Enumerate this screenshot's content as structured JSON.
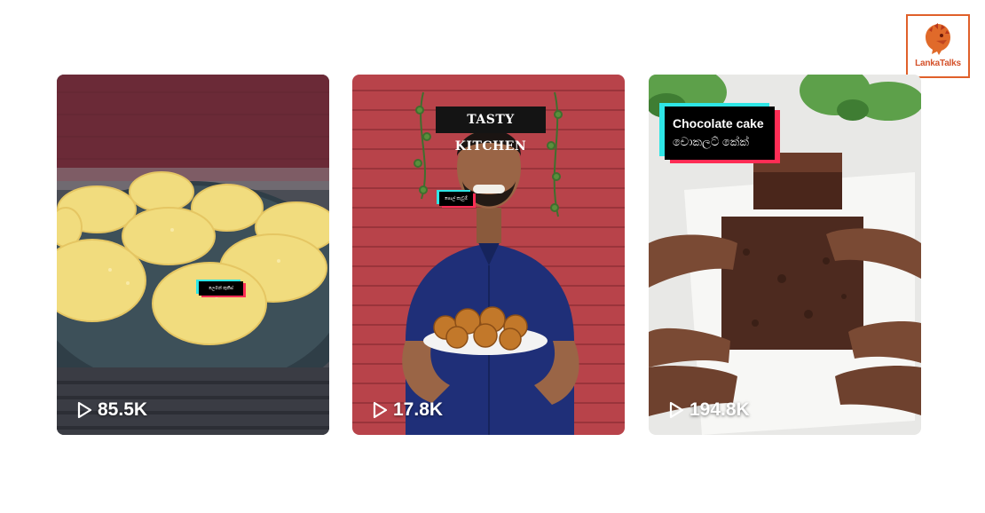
{
  "logo": {
    "text": "LankaTalks",
    "icon": "lion-icon"
  },
  "colors": {
    "accent_orange": "#e0602a",
    "tag_cyan": "#2ee6e6",
    "tag_pink": "#ff2d55"
  },
  "videos": [
    {
      "views": "85.5K",
      "tag_text": "ලෙමන් කුකීස්",
      "play_icon": "play-icon"
    },
    {
      "views": "17.8K",
      "tag_text": "පොල් කැවුම්",
      "sign_text": "TASTY KITCHEN",
      "play_icon": "play-icon"
    },
    {
      "views": "194.8K",
      "caption_line1": "Chocolate cake",
      "caption_line2": "චොකලට් කේක්",
      "play_icon": "play-icon"
    }
  ]
}
